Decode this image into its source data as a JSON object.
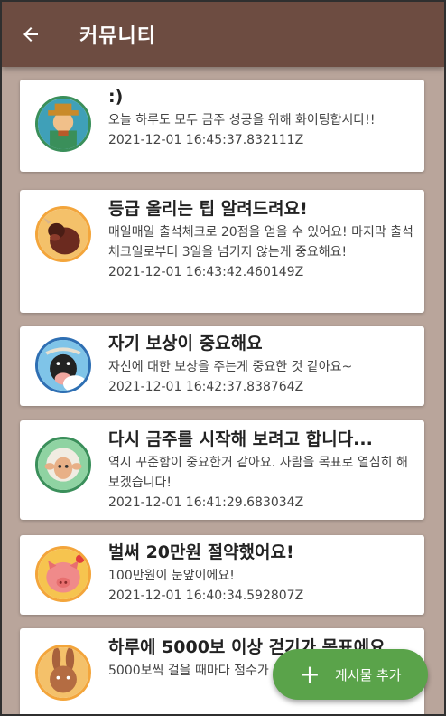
{
  "header": {
    "title": "커뮤니티",
    "back_icon": "arrow-left-icon"
  },
  "posts": [
    {
      "title": ":)",
      "body": "오늘 하루도 모두 금주 성공을 위해 화이팅합시다!!",
      "time": "2021-12-01 16:45:37.832111Z",
      "avatar": "farmer-avatar"
    },
    {
      "title": "등급 올리는 팁 알려드려요!",
      "body": "매일매일 출석체크로 20점을 얻을 수 있어요! 마지막 출석체크일로부터 3일을 넘기지 않는게 중요해요!",
      "time": "2021-12-01 16:43:42.460149Z",
      "avatar": "bull-avatar"
    },
    {
      "title": "자기 보상이 중요해요",
      "body": "자신에 대한 보상을 주는게 중요한 것 같아요~",
      "time": "2021-12-01 16:42:37.838764Z",
      "avatar": "cow-avatar"
    },
    {
      "title": "다시 금주를 시작해 보려고 합니다...",
      "body": "역시 꾸준함이 중요한거 같아요. 사람을 목표로 열심히 해보겠습니다!",
      "time": "2021-12-01 16:41:29.683034Z",
      "avatar": "sheep-avatar"
    },
    {
      "title": "벌써 20만원 절약했어요!",
      "body": "100만원이 눈앞이에요!",
      "time": "2021-12-01 16:40:34.592807Z",
      "avatar": "pig-avatar"
    },
    {
      "title": "하루에 5000보 이상 걷기가 목표에요",
      "body": "5000보씩 걸을 때마다 점수가 5점씩 증가하네",
      "time": "",
      "avatar": "rabbit-avatar"
    }
  ],
  "fab": {
    "label": "게시물 추가",
    "icon": "plus-icon"
  },
  "colors": {
    "appbar": "#6d4c41",
    "background": "#b9a59b",
    "fab": "#5aa34a"
  }
}
